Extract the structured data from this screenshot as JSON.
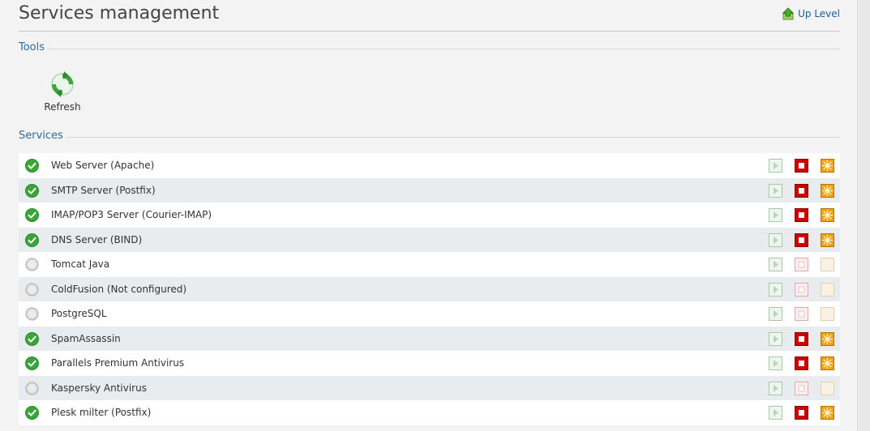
{
  "header": {
    "title": "Services management",
    "up_level_label": "Up Level"
  },
  "tools": {
    "section_label": "Tools",
    "refresh_label": "Refresh"
  },
  "services": {
    "section_label": "Services",
    "rows": [
      {
        "name": "Web Server (Apache)",
        "running": true
      },
      {
        "name": "SMTP Server (Postfix)",
        "running": true
      },
      {
        "name": "IMAP/POP3 Server (Courier-IMAP)",
        "running": true
      },
      {
        "name": "DNS Server (BIND)",
        "running": true
      },
      {
        "name": "Tomcat Java",
        "running": false
      },
      {
        "name": "ColdFusion (Not configured)",
        "running": false
      },
      {
        "name": "PostgreSQL",
        "running": false
      },
      {
        "name": "SpamAssassin",
        "running": true
      },
      {
        "name": "Parallels Premium Antivirus",
        "running": true
      },
      {
        "name": "Kaspersky Antivirus",
        "running": false
      },
      {
        "name": "Plesk milter (Postfix)",
        "running": true
      }
    ]
  },
  "icons": {
    "up_level": "up-arrow-icon",
    "refresh": "refresh-icon",
    "status_on": "check-circle-icon",
    "status_off": "grey-circle-icon",
    "start": "play-icon",
    "stop": "stop-icon",
    "restart": "restart-icon"
  },
  "colors": {
    "link": "#1e5b9a",
    "section": "#2c6aa0",
    "status_on": "#3aa63a",
    "stop": "#cc0000",
    "restart": "#f0a018"
  }
}
